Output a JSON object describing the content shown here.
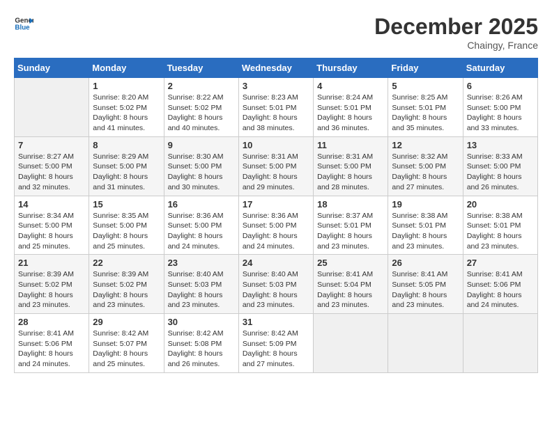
{
  "header": {
    "logo_line1": "General",
    "logo_line2": "Blue",
    "month_title": "December 2025",
    "location": "Chaingy, France"
  },
  "days_of_week": [
    "Sunday",
    "Monday",
    "Tuesday",
    "Wednesday",
    "Thursday",
    "Friday",
    "Saturday"
  ],
  "weeks": [
    [
      {
        "day": "",
        "info": ""
      },
      {
        "day": "1",
        "info": "Sunrise: 8:20 AM\nSunset: 5:02 PM\nDaylight: 8 hours\nand 41 minutes."
      },
      {
        "day": "2",
        "info": "Sunrise: 8:22 AM\nSunset: 5:02 PM\nDaylight: 8 hours\nand 40 minutes."
      },
      {
        "day": "3",
        "info": "Sunrise: 8:23 AM\nSunset: 5:01 PM\nDaylight: 8 hours\nand 38 minutes."
      },
      {
        "day": "4",
        "info": "Sunrise: 8:24 AM\nSunset: 5:01 PM\nDaylight: 8 hours\nand 36 minutes."
      },
      {
        "day": "5",
        "info": "Sunrise: 8:25 AM\nSunset: 5:01 PM\nDaylight: 8 hours\nand 35 minutes."
      },
      {
        "day": "6",
        "info": "Sunrise: 8:26 AM\nSunset: 5:00 PM\nDaylight: 8 hours\nand 33 minutes."
      }
    ],
    [
      {
        "day": "7",
        "info": "Sunrise: 8:27 AM\nSunset: 5:00 PM\nDaylight: 8 hours\nand 32 minutes."
      },
      {
        "day": "8",
        "info": "Sunrise: 8:29 AM\nSunset: 5:00 PM\nDaylight: 8 hours\nand 31 minutes."
      },
      {
        "day": "9",
        "info": "Sunrise: 8:30 AM\nSunset: 5:00 PM\nDaylight: 8 hours\nand 30 minutes."
      },
      {
        "day": "10",
        "info": "Sunrise: 8:31 AM\nSunset: 5:00 PM\nDaylight: 8 hours\nand 29 minutes."
      },
      {
        "day": "11",
        "info": "Sunrise: 8:31 AM\nSunset: 5:00 PM\nDaylight: 8 hours\nand 28 minutes."
      },
      {
        "day": "12",
        "info": "Sunrise: 8:32 AM\nSunset: 5:00 PM\nDaylight: 8 hours\nand 27 minutes."
      },
      {
        "day": "13",
        "info": "Sunrise: 8:33 AM\nSunset: 5:00 PM\nDaylight: 8 hours\nand 26 minutes."
      }
    ],
    [
      {
        "day": "14",
        "info": "Sunrise: 8:34 AM\nSunset: 5:00 PM\nDaylight: 8 hours\nand 25 minutes."
      },
      {
        "day": "15",
        "info": "Sunrise: 8:35 AM\nSunset: 5:00 PM\nDaylight: 8 hours\nand 25 minutes."
      },
      {
        "day": "16",
        "info": "Sunrise: 8:36 AM\nSunset: 5:00 PM\nDaylight: 8 hours\nand 24 minutes."
      },
      {
        "day": "17",
        "info": "Sunrise: 8:36 AM\nSunset: 5:00 PM\nDaylight: 8 hours\nand 24 minutes."
      },
      {
        "day": "18",
        "info": "Sunrise: 8:37 AM\nSunset: 5:01 PM\nDaylight: 8 hours\nand 23 minutes."
      },
      {
        "day": "19",
        "info": "Sunrise: 8:38 AM\nSunset: 5:01 PM\nDaylight: 8 hours\nand 23 minutes."
      },
      {
        "day": "20",
        "info": "Sunrise: 8:38 AM\nSunset: 5:01 PM\nDaylight: 8 hours\nand 23 minutes."
      }
    ],
    [
      {
        "day": "21",
        "info": "Sunrise: 8:39 AM\nSunset: 5:02 PM\nDaylight: 8 hours\nand 23 minutes."
      },
      {
        "day": "22",
        "info": "Sunrise: 8:39 AM\nSunset: 5:02 PM\nDaylight: 8 hours\nand 23 minutes."
      },
      {
        "day": "23",
        "info": "Sunrise: 8:40 AM\nSunset: 5:03 PM\nDaylight: 8 hours\nand 23 minutes."
      },
      {
        "day": "24",
        "info": "Sunrise: 8:40 AM\nSunset: 5:03 PM\nDaylight: 8 hours\nand 23 minutes."
      },
      {
        "day": "25",
        "info": "Sunrise: 8:41 AM\nSunset: 5:04 PM\nDaylight: 8 hours\nand 23 minutes."
      },
      {
        "day": "26",
        "info": "Sunrise: 8:41 AM\nSunset: 5:05 PM\nDaylight: 8 hours\nand 23 minutes."
      },
      {
        "day": "27",
        "info": "Sunrise: 8:41 AM\nSunset: 5:06 PM\nDaylight: 8 hours\nand 24 minutes."
      }
    ],
    [
      {
        "day": "28",
        "info": "Sunrise: 8:41 AM\nSunset: 5:06 PM\nDaylight: 8 hours\nand 24 minutes."
      },
      {
        "day": "29",
        "info": "Sunrise: 8:42 AM\nSunset: 5:07 PM\nDaylight: 8 hours\nand 25 minutes."
      },
      {
        "day": "30",
        "info": "Sunrise: 8:42 AM\nSunset: 5:08 PM\nDaylight: 8 hours\nand 26 minutes."
      },
      {
        "day": "31",
        "info": "Sunrise: 8:42 AM\nSunset: 5:09 PM\nDaylight: 8 hours\nand 27 minutes."
      },
      {
        "day": "",
        "info": ""
      },
      {
        "day": "",
        "info": ""
      },
      {
        "day": "",
        "info": ""
      }
    ]
  ]
}
